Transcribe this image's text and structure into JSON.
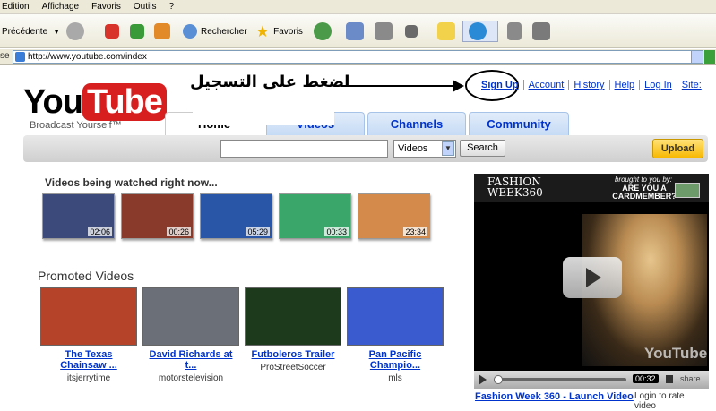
{
  "browser": {
    "menu": [
      "Edition",
      "Affichage",
      "Favoris",
      "Outils",
      "?"
    ],
    "toolbar": {
      "back_label": "Précédente",
      "search_label": "Rechercher",
      "favorites_label": "Favoris"
    },
    "address": {
      "label": "se",
      "url": "http://www.youtube.com/index"
    }
  },
  "youtube": {
    "logo_you": "You",
    "logo_tube": "Tube",
    "tagline": "Broadcast Yourself™",
    "annotation_text": "اضغط على التسجيل",
    "top_links": [
      "Sign Up",
      "Account",
      "History",
      "Help",
      "Log In",
      "Site:"
    ],
    "tabs": [
      "Home",
      "Videos",
      "Channels",
      "Community"
    ],
    "search": {
      "category": "Videos",
      "button": "Search",
      "upload": "Upload"
    },
    "watching_title": "Videos being watched right now...",
    "watching": [
      {
        "duration": "02:06",
        "color": "#3b4a7a"
      },
      {
        "duration": "00:26",
        "color": "#8a3a2a"
      },
      {
        "duration": "05:29",
        "color": "#2a56a8"
      },
      {
        "duration": "00:33",
        "color": "#3aa66a"
      },
      {
        "duration": "23:34",
        "color": "#d48a4a"
      }
    ],
    "promoted_title": "Promoted Videos",
    "promoted": [
      {
        "title_1": "The Texas",
        "title_2": "Chainsaw ...",
        "user": "itsjerrytime",
        "color": "#b5432a"
      },
      {
        "title_1": "David Richards at t...",
        "title_2": "",
        "user": "motorstelevision",
        "color": "#6a6f78"
      },
      {
        "title_1": "Futboleros Trailer",
        "title_2": "",
        "user": "ProStreetSoccer",
        "color": "#1d3a1d"
      },
      {
        "title_1": "Pan Pacific",
        "title_2": "Champio...",
        "user": "mls",
        "color": "#3a5ad0"
      }
    ],
    "player": {
      "banner_line1": "FASHION",
      "banner_line2": "WEEK360",
      "brought_by": "brought to you by:",
      "card_question": "ARE YOU A CARDMEMBER?",
      "watermark": "YouTube",
      "time": "00:32",
      "share": "share",
      "progress": 0.02,
      "caption": "Fashion Week 360 - Launch Video",
      "rate": "Login to rate video"
    }
  }
}
